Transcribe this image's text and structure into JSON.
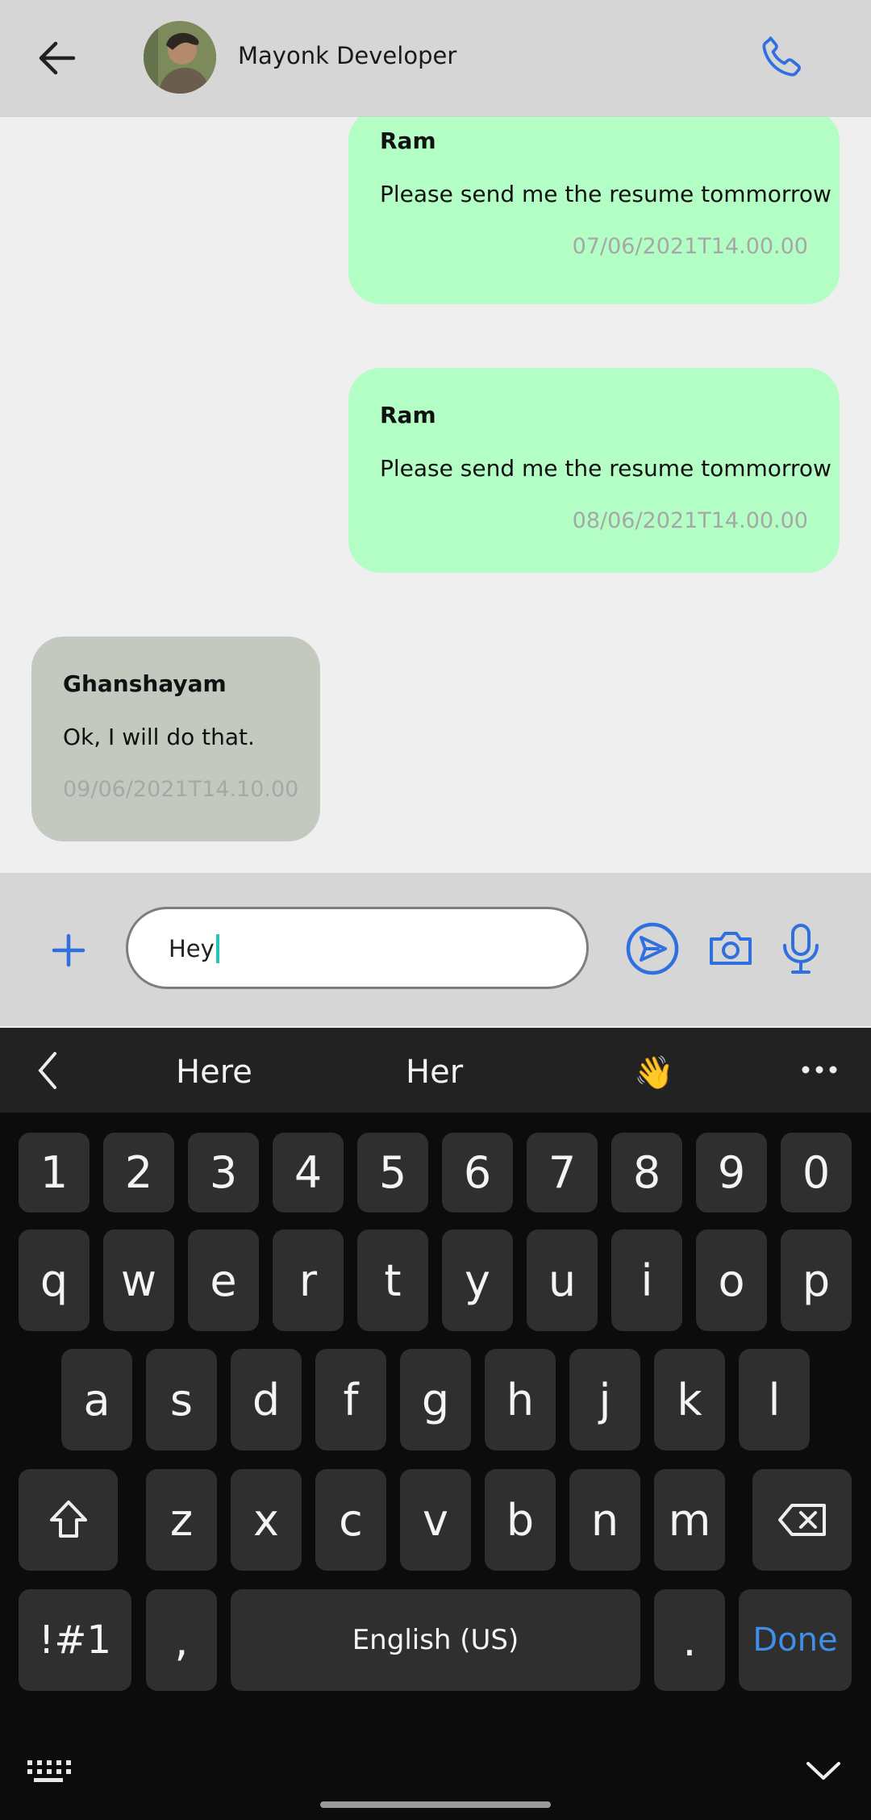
{
  "header": {
    "contact_name": "Mayonk Developer",
    "back_icon": "arrow-left-icon",
    "call_icon": "phone-icon"
  },
  "messages": [
    {
      "sender": "Ram",
      "text": "Please send me the resume tommorrow",
      "time": "07/06/2021T14.00.00",
      "side": "outgoing"
    },
    {
      "sender": "Ram",
      "text": "Please send me the resume tommorrow",
      "time": "08/06/2021T14.00.00",
      "side": "outgoing"
    },
    {
      "sender": "Ghanshayam",
      "text": "Ok, I will do that.",
      "time": "09/06/2021T14.10.00",
      "side": "incoming"
    }
  ],
  "composer": {
    "input_value": "Hey",
    "add_icon": "plus-icon",
    "send_icon": "send-icon",
    "camera_icon": "camera-icon",
    "mic_icon": "microphone-icon"
  },
  "keyboard": {
    "suggestions": [
      "Here",
      "Her",
      "👋"
    ],
    "number_row": [
      "1",
      "2",
      "3",
      "4",
      "5",
      "6",
      "7",
      "8",
      "9",
      "0"
    ],
    "row1": [
      "q",
      "w",
      "e",
      "r",
      "t",
      "y",
      "u",
      "i",
      "o",
      "p"
    ],
    "row2": [
      "a",
      "s",
      "d",
      "f",
      "g",
      "h",
      "j",
      "k",
      "l"
    ],
    "row3": [
      "z",
      "x",
      "c",
      "v",
      "b",
      "n",
      "m"
    ],
    "symbols_key": "!#1",
    "comma_key": ",",
    "space_key": "English (US)",
    "period_key": ".",
    "done_key": "Done"
  },
  "colors": {
    "outgoing_bubble": "#b3fec4",
    "incoming_bubble": "#c4c9c0",
    "accent": "#2f6fe0",
    "done_key": "#3f8fe8"
  }
}
